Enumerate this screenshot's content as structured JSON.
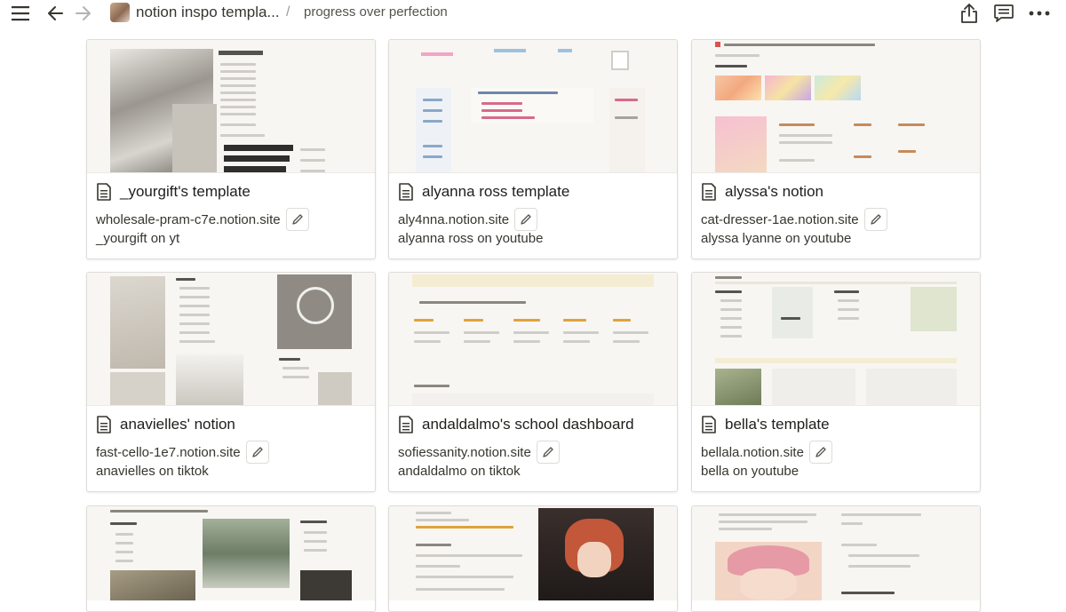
{
  "header": {
    "breadcrumb_page": "notion inspo templa...",
    "separator": "/",
    "current_page": "progress over perfection",
    "icons": [
      "menu-icon",
      "back-arrow-icon",
      "forward-arrow-icon",
      "share-icon",
      "comment-icon",
      "more-icon"
    ]
  },
  "cards": [
    {
      "title": "_yourgift's template",
      "url": "wholesale-pram-c7e.notion.site",
      "source": "_yourgift on yt"
    },
    {
      "title": "alyanna ross template",
      "url": "aly4nna.notion.site",
      "source": "alyanna ross on youtube"
    },
    {
      "title": "alyssa's notion",
      "url": "cat-dresser-1ae.notion.site",
      "source": "alyssa lyanne on youtube"
    },
    {
      "title": "anavielles' notion",
      "url": "fast-cello-1e7.notion.site",
      "source": "anavielles on tiktok"
    },
    {
      "title": "andaldalmo's school dashboard",
      "url": "sofiessanity.notion.site",
      "source": "andaldalmo on tiktok"
    },
    {
      "title": "bella's template",
      "url": "bellala.notion.site",
      "source": "bella on youtube"
    },
    {
      "title": "",
      "url": "",
      "source": ""
    },
    {
      "title": "",
      "url": "",
      "source": ""
    },
    {
      "title": "",
      "url": "",
      "source": ""
    }
  ],
  "colors": {
    "border": "#dedcd8",
    "text": "#37352f",
    "muted": "#9b9a97"
  }
}
